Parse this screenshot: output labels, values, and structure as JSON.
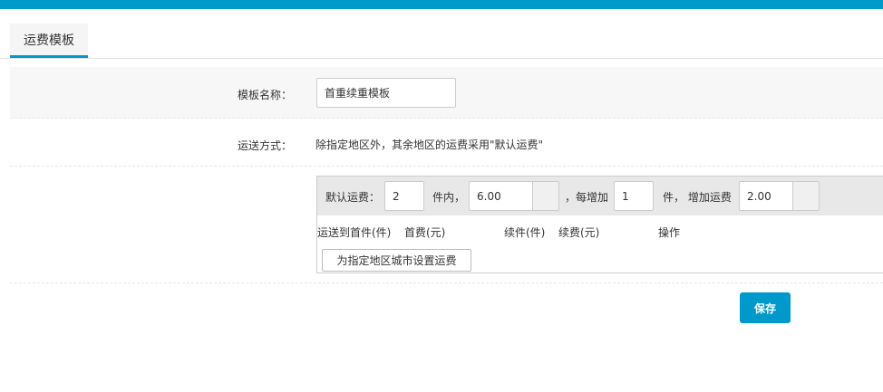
{
  "tabs": [
    {
      "label": "运费模板",
      "active": true
    }
  ],
  "form": {
    "template_name": {
      "label": "模板名称：",
      "value": "首重续重模板"
    },
    "shipping_method": {
      "label": "运送方式：",
      "description": "除指定地区外，其余地区的运费采用\"默认运费\""
    }
  },
  "default_fee": {
    "label": "默认运费：",
    "first_qty": "2",
    "within_text": "件内，",
    "first_fee": "6.00",
    "each_add_text": "，每增加",
    "add_qty": "1",
    "unit_add_text": "件， 增加运费",
    "add_fee": "2.00"
  },
  "columns": [
    "运送到首件(件)",
    "首费(元)",
    "续件(件)",
    "续费(元)",
    "操作"
  ],
  "set_region_button": "为指定地区城市设置运费",
  "save_button": "保存",
  "colors": {
    "accent": "#0099cc",
    "row_bg": "#f7f7f7",
    "fee_bar_bg": "#e8e8e8"
  }
}
